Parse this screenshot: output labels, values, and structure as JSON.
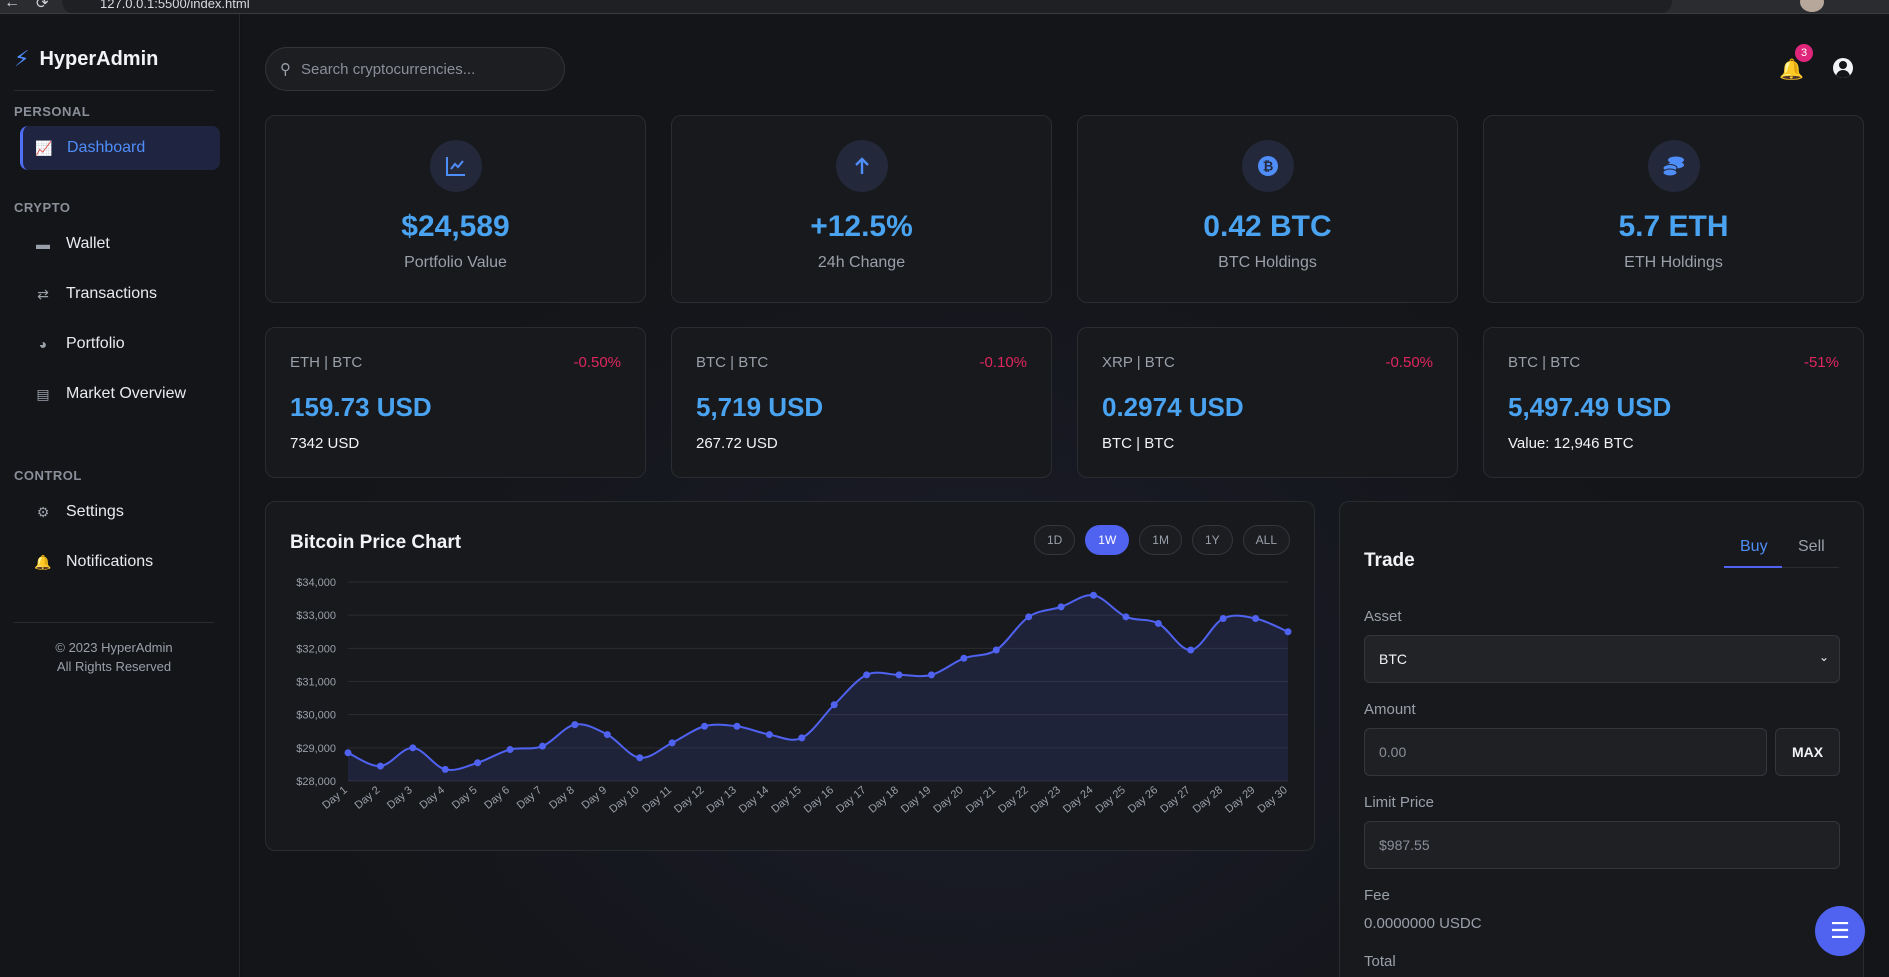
{
  "browser": {
    "url": "127.0.0.1:5500/index.html"
  },
  "sidebar": {
    "brand": "HyperAdmin",
    "sections": {
      "personal": "PERSONAL",
      "crypto": "CRYPTO",
      "control": "CONTROL"
    },
    "items": [
      {
        "label": "Dashboard",
        "icon": "line-chart-icon",
        "active": true
      },
      {
        "label": "Wallet",
        "icon": "wallet-icon"
      },
      {
        "label": "Transactions",
        "icon": "exchange-arrows-icon"
      },
      {
        "label": "Portfolio",
        "icon": "pie-chart-icon"
      },
      {
        "label": "Market Overview",
        "icon": "bar-chart-icon"
      },
      {
        "label": "Settings",
        "icon": "gear-icon"
      },
      {
        "label": "Notifications",
        "icon": "bell-icon"
      }
    ],
    "copyright_line1": "© 2023 HyperAdmin",
    "copyright_line2": "All Rights Reserved"
  },
  "header": {
    "search_placeholder": "Search cryptocurrencies...",
    "notification_count": "3"
  },
  "stats": [
    {
      "value": "$24,589",
      "label": "Portfolio Value",
      "icon": "line-chart-icon"
    },
    {
      "value": "+12.5%",
      "label": "24h Change",
      "icon": "arrow-up-icon"
    },
    {
      "value": "0.42 BTC",
      "label": "BTC Holdings",
      "icon": "bitcoin-icon"
    },
    {
      "value": "5.7 ETH",
      "label": "ETH Holdings",
      "icon": "coins-icon"
    }
  ],
  "pairs": [
    {
      "name": "ETH | BTC",
      "change": "-0.50%",
      "price": "159.73 USD",
      "sub": "7342 USD"
    },
    {
      "name": "BTC | BTC",
      "change": "-0.10%",
      "price": "5,719 USD",
      "sub": "267.72 USD"
    },
    {
      "name": "XRP | BTC",
      "change": "-0.50%",
      "price": "0.2974 USD",
      "sub": "BTC | BTC"
    },
    {
      "name": "BTC | BTC",
      "change": "-51%",
      "price": "5,497.49 USD",
      "sub": "Value: 12,946 BTC"
    }
  ],
  "chart": {
    "title": "Bitcoin Price Chart",
    "ranges": [
      "1D",
      "1W",
      "1M",
      "1Y",
      "ALL"
    ],
    "active_range": "1W",
    "accent": "#4f62f0"
  },
  "chart_data": {
    "type": "area",
    "categories": [
      "Day 1",
      "Day 2",
      "Day 3",
      "Day 4",
      "Day 5",
      "Day 6",
      "Day 7",
      "Day 8",
      "Day 9",
      "Day 10",
      "Day 11",
      "Day 12",
      "Day 13",
      "Day 14",
      "Day 15",
      "Day 16",
      "Day 17",
      "Day 18",
      "Day 19",
      "Day 20",
      "Day 21",
      "Day 22",
      "Day 23",
      "Day 24",
      "Day 25",
      "Day 26",
      "Day 27",
      "Day 28",
      "Day 29",
      "Day 30"
    ],
    "values": [
      28850,
      28450,
      29000,
      28350,
      28550,
      28950,
      29050,
      29700,
      29400,
      28700,
      29150,
      29650,
      29650,
      29400,
      29300,
      30300,
      31200,
      31200,
      31200,
      31700,
      31950,
      32950,
      33250,
      33600,
      32950,
      32750,
      31950,
      32900,
      32900,
      32500
    ],
    "ylim": [
      28000,
      34000
    ],
    "yticks": [
      "$28,000",
      "$29,000",
      "$30,000",
      "$31,000",
      "$32,000",
      "$33,000",
      "$34,000"
    ],
    "grid": true,
    "color": "#4f62f0"
  },
  "trade": {
    "title": "Trade",
    "tab_buy": "Buy",
    "tab_sell": "Sell",
    "asset_label": "Asset",
    "asset_value": "BTC",
    "amount_label": "Amount",
    "amount_placeholder": "0.00",
    "max_label": "MAX",
    "limit_label": "Limit Price",
    "limit_placeholder": "$987.55",
    "fee_label": "Fee",
    "fee_value": "0.0000000 USDC",
    "total_label": "Total"
  }
}
